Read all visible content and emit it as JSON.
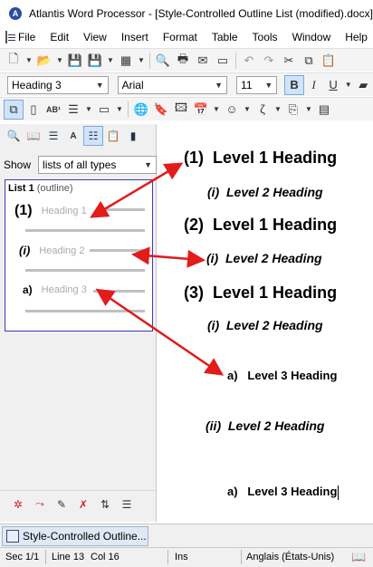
{
  "window": {
    "title": "Atlantis Word Processor - [Style-Controlled Outline List (modified).docx]",
    "logo": "A"
  },
  "menu": [
    "File",
    "Edit",
    "View",
    "Insert",
    "Format",
    "Table",
    "Tools",
    "Window",
    "Help"
  ],
  "format_bar": {
    "style": "Heading 3",
    "font": "Arial",
    "size": "11",
    "bold": "B",
    "italic": "I",
    "underline": "U"
  },
  "left_pane": {
    "show_label": "Show",
    "show_value": "lists of all types",
    "list_title_bold": "List 1",
    "list_title_rest": "(outline)",
    "levels": [
      {
        "number": "(1)",
        "style": "Heading 1"
      },
      {
        "number": "(i)",
        "style": "Heading 2"
      },
      {
        "number": "a)",
        "style": "Heading 3"
      }
    ]
  },
  "document": {
    "lines": [
      {
        "number": "(1)",
        "text": "Level 1 Heading"
      },
      {
        "number": "(i)",
        "text": "Level 2 Heading"
      },
      {
        "number": "(2)",
        "text": "Level 1 Heading"
      },
      {
        "number": "(i)",
        "text": "Level 2 Heading"
      },
      {
        "number": "(3)",
        "text": "Level 1 Heading"
      },
      {
        "number": "(i)",
        "text": "Level 2 Heading"
      },
      {
        "number": "a)",
        "text": "Level 3 Heading"
      },
      {
        "number": "(ii)",
        "text": "Level 2 Heading"
      },
      {
        "number": "a)",
        "text": "Level 3 Heading"
      }
    ]
  },
  "taskbar": {
    "doc_tab": "Style-Controlled Outline..."
  },
  "status": {
    "section": "Sec 1/1",
    "line": "Line 13",
    "col": "Col 16",
    "mode": "Ins",
    "language": "Anglais (États-Unis)"
  },
  "colors": {
    "arrow": "#e21b1b",
    "list_border": "#3b3bb5",
    "accent": "#cfe3fb"
  }
}
